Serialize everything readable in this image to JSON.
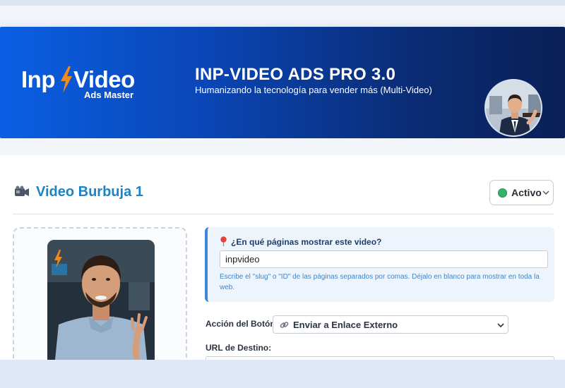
{
  "colors": {
    "banner_start": "#0b5fe3",
    "banner_end": "#0a1f55",
    "title_blue": "#1a84c7",
    "status_green": "#34b36b",
    "help_blue": "#3f86c9",
    "panel_accent": "#3d86d8",
    "bolt_orange": "#f08a1c"
  },
  "logo": {
    "part1": "Inp",
    "part2": "Video",
    "subtitle": "Ads Master",
    "icon": "lightning-bolt-icon"
  },
  "header": {
    "title": "INP-VIDEO ADS PRO 3.0",
    "subtitle": "Humanizando la tecnología para vender más (Multi-Video)",
    "avatar": "presenter-avatar"
  },
  "video_card": {
    "icon": "video-camera-icon",
    "title": "Video Burbuja 1",
    "status": {
      "label": "Activo",
      "color": "#34b36b"
    },
    "thumbnail": "presenter-video-thumbnail"
  },
  "pages": {
    "icon": "pushpin-icon",
    "label": "¿En qué páginas mostrar este video?",
    "value": "inpvideo",
    "help": "Escribe el \"slug\" o \"ID\" de las páginas separados por comas. Déjalo en blanco para mostrar en toda la web."
  },
  "button_action": {
    "label": "Acción del Botón:",
    "icon": "link-icon",
    "value": "Enviar a Enlace Externo"
  },
  "destination": {
    "label": "URL de Destino:",
    "value": ""
  }
}
